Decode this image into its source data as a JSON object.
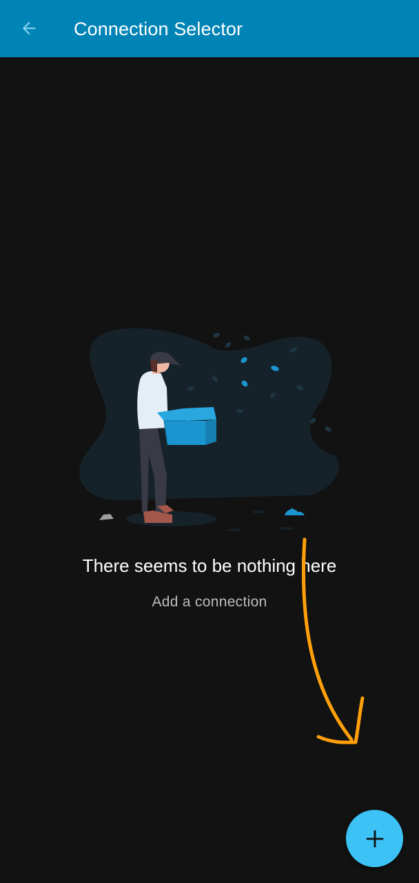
{
  "app_bar": {
    "title": "Connection Selector",
    "back_icon": "arrow-left-icon",
    "color": "#0083b5"
  },
  "empty_state": {
    "title": "There seems to be nothing here",
    "subtitle": "Add a connection",
    "illustration": "person-holding-empty-box-illustration"
  },
  "hint_arrow": {
    "icon": "hand-drawn-arrow-icon",
    "color": "#ff9f0a"
  },
  "fab": {
    "icon": "plus-icon",
    "color": "#3cc2f5"
  },
  "colors": {
    "background": "#121212",
    "accent": "#3cc2f5"
  }
}
